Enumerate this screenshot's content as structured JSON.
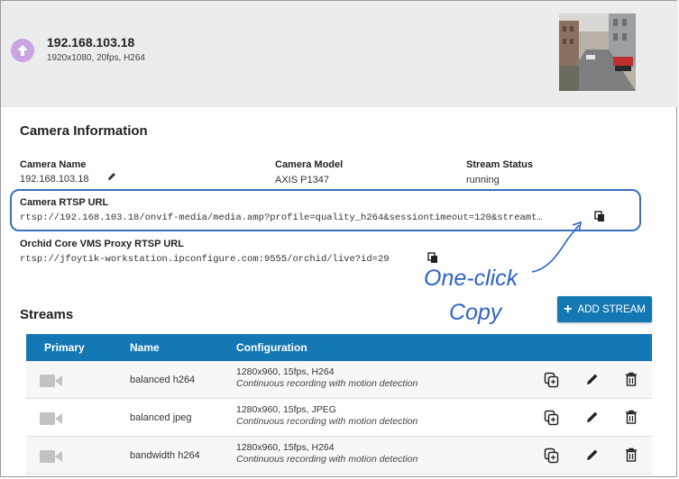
{
  "header": {
    "camera_ip": "192.168.103.18",
    "camera_specs": "1920x1080, 20fps, H264"
  },
  "camera_info": {
    "title": "Camera Information",
    "name_label": "Camera Name",
    "name_value": "192.168.103.18",
    "model_label": "Camera Model",
    "model_value": "AXIS P1347",
    "status_label": "Stream Status",
    "status_value": "running",
    "rtsp_label": "Camera RTSP URL",
    "rtsp_value": "rtsp://192.168.103.18/onvif-media/media.amp?profile=quality_h264&sessiontimeout=120&streamt…",
    "proxy_label": "Orchid Core VMS Proxy RTSP URL",
    "proxy_value": "rtsp://jfoytik-workstation.ipconfigure.com:9555/orchid/live?id=29"
  },
  "annotation": {
    "line1": "One-click",
    "line2": "Copy"
  },
  "streams": {
    "title": "Streams",
    "add_label": "ADD STREAM",
    "columns": {
      "primary": "Primary",
      "name": "Name",
      "configuration": "Configuration"
    },
    "rows": [
      {
        "name": "balanced h264",
        "config": "1280x960, 15fps, H264",
        "note": "Continuous recording with motion detection"
      },
      {
        "name": "balanced jpeg",
        "config": "1280x960, 15fps, JPEG",
        "note": "Continuous recording with motion detection"
      },
      {
        "name": "bandwidth h264",
        "config": "1280x960, 15fps, H264",
        "note": "Continuous recording with motion detection"
      }
    ]
  },
  "colors": {
    "accent": "#1478b4",
    "annotation": "#2f63c8",
    "header_bg": "#ececec",
    "up_icon": "#c9a4e0"
  }
}
